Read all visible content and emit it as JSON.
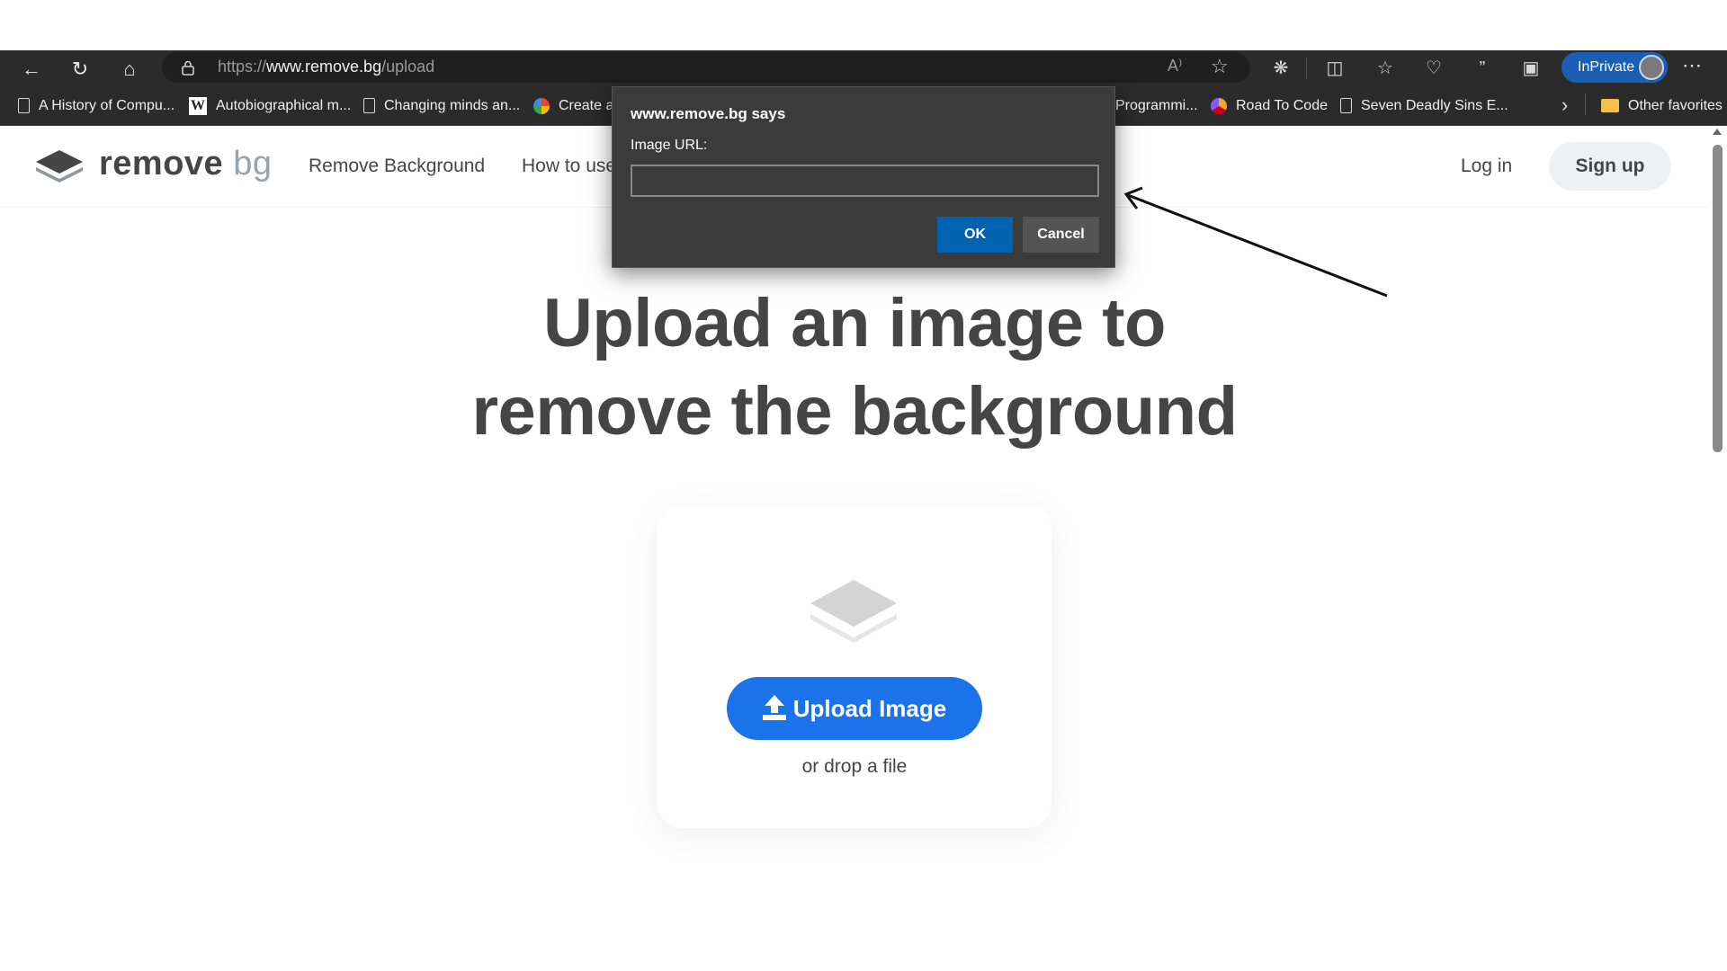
{
  "browser": {
    "url_prefix": "https://",
    "url_domain": "www.remove.bg",
    "url_path": "/upload",
    "read_aloud_label": "A⁾",
    "inprivate_label": "InPrivate",
    "bookmarks": [
      {
        "label": "A History of Compu...",
        "icon": "document-icon"
      },
      {
        "label": "Autobiographical m...",
        "icon": "wikipedia-icon"
      },
      {
        "label": "Changing minds an...",
        "icon": "document-icon"
      },
      {
        "label": "Create ar",
        "icon": "google-cloud-icon"
      },
      {
        "label": "Programmi...",
        "icon": "document-icon"
      },
      {
        "label": "Road To Code",
        "icon": "roadtocode-icon"
      },
      {
        "label": "Seven Deadly Sins E...",
        "icon": "document-icon"
      }
    ],
    "other_favorites": "Other favorites",
    "accent": "#1a5fb4"
  },
  "site": {
    "logo_main": "remove",
    "logo_suffix": "bg",
    "nav": [
      "Remove Background",
      "How to use"
    ],
    "login": "Log in",
    "signup": "Sign up",
    "headline_line1": "Upload an image to",
    "headline_line2": "remove the background",
    "upload_button": "Upload Image",
    "drop_text": "or drop a file",
    "brand_color": "#1a73e8"
  },
  "dialog": {
    "title": "www.remove.bg says",
    "label": "Image URL:",
    "input_value": "",
    "ok": "OK",
    "cancel": "Cancel"
  }
}
